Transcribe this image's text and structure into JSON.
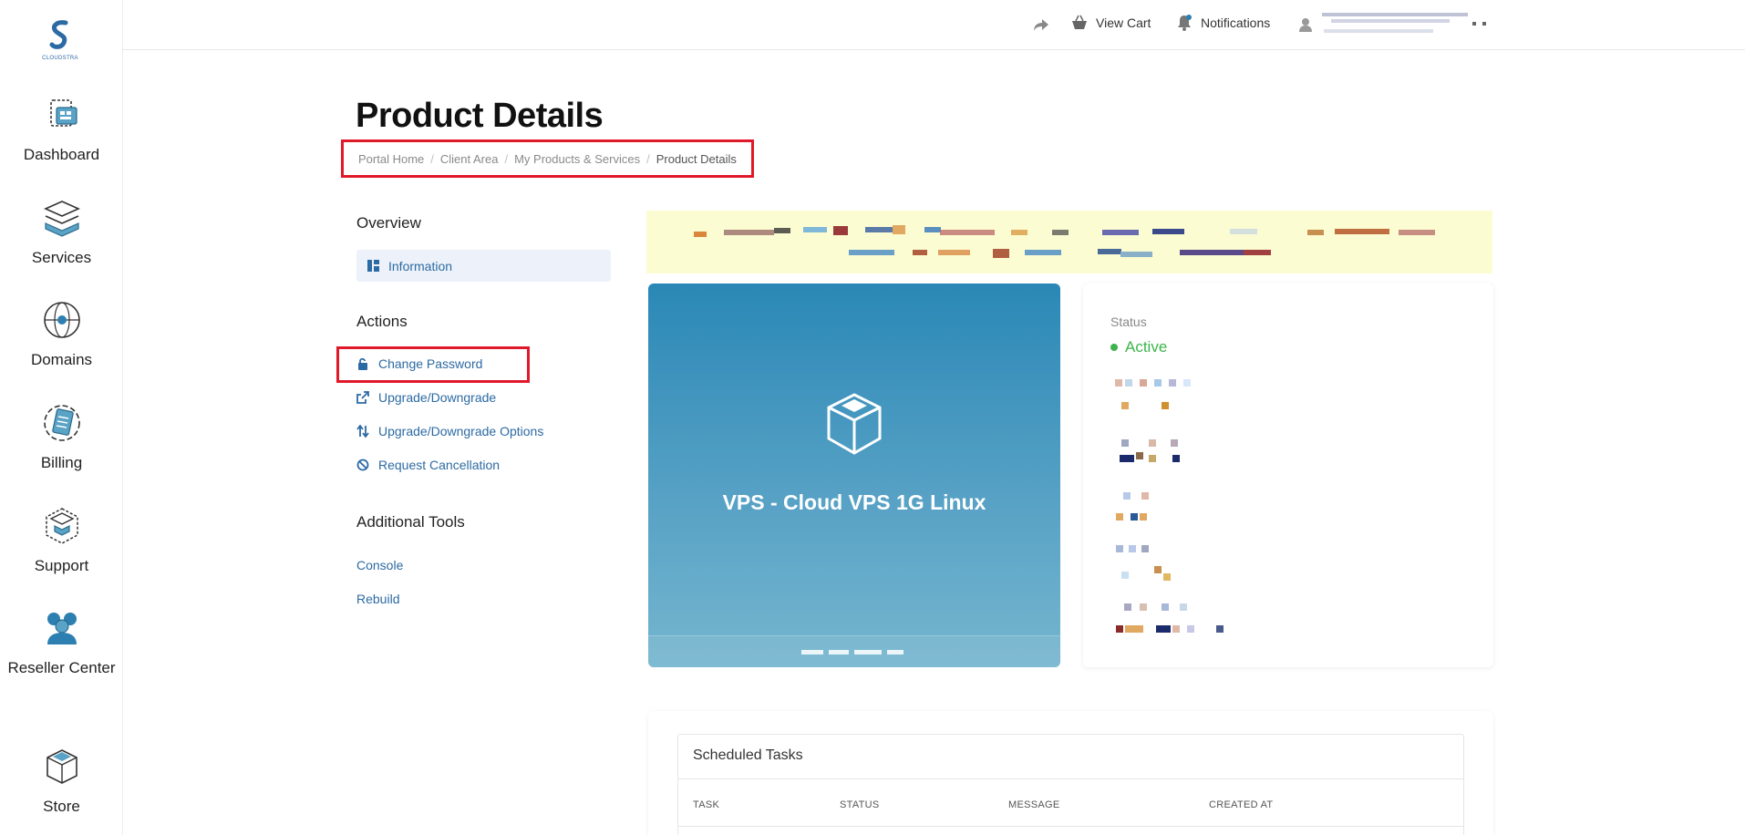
{
  "topbar": {
    "view_cart": "View Cart",
    "notifications": "Notifications"
  },
  "sidebar": {
    "items": [
      {
        "label": "Dashboard"
      },
      {
        "label": "Services"
      },
      {
        "label": "Domains"
      },
      {
        "label": "Billing"
      },
      {
        "label": "Support"
      },
      {
        "label": "Reseller Center"
      },
      {
        "label": "Store"
      }
    ]
  },
  "page": {
    "title": "Product Details"
  },
  "breadcrumb": {
    "items": [
      "Portal Home",
      "Client Area",
      "My Products & Services",
      "Product Details"
    ]
  },
  "overview": {
    "heading": "Overview",
    "information": "Information"
  },
  "actions": {
    "heading": "Actions",
    "change_password": "Change Password",
    "upgrade_downgrade": "Upgrade/Downgrade",
    "upgrade_downgrade_options": "Upgrade/Downgrade Options",
    "request_cancellation": "Request Cancellation"
  },
  "tools": {
    "heading": "Additional Tools",
    "console": "Console",
    "rebuild": "Rebuild"
  },
  "product": {
    "name": "VPS - Cloud VPS 1G Linux"
  },
  "status": {
    "label": "Status",
    "value": "Active",
    "color": "#3cb44b"
  },
  "tasks": {
    "title": "Scheduled Tasks",
    "columns": [
      "TASK",
      "STATUS",
      "MESSAGE",
      "CREATED AT"
    ]
  },
  "colors": {
    "link": "#2c6aa3",
    "highlight": "#e0192a",
    "alert_bg": "#fcfcd2"
  }
}
